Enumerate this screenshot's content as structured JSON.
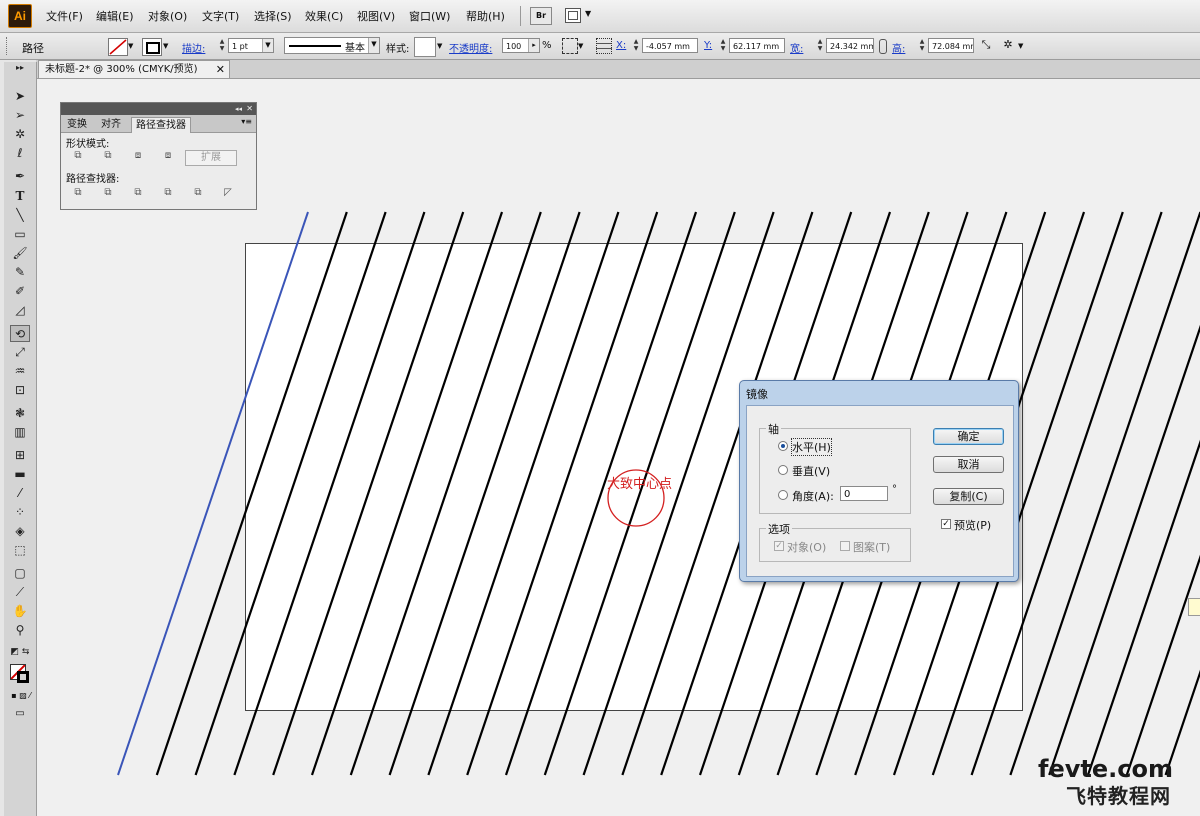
{
  "app": {
    "logo": "Ai"
  },
  "menu": [
    "文件(F)",
    "编辑(E)",
    "对象(O)",
    "文字(T)",
    "选择(S)",
    "效果(C)",
    "视图(V)",
    "窗口(W)",
    "帮助(H)"
  ],
  "control_bar": {
    "selection_label": "路径",
    "stroke_label": "描边:",
    "stroke_weight": "1 pt",
    "brush_label": "基本",
    "style_label": "样式:",
    "opacity_label": "不透明度:",
    "opacity_value": "100",
    "opacity_unit": "%",
    "x_label": "X:",
    "x_value": "-4.057 mm",
    "y_label": "Y:",
    "y_value": "62.117 mm",
    "w_label": "宽:",
    "w_value": "24.342 mm",
    "h_label": "高:",
    "h_value": "72.084 mm",
    "bridge_label": "Br"
  },
  "document": {
    "tab_title": "未标题-2* @ 300% (CMYK/预览)"
  },
  "pathfinder_panel": {
    "tabs": [
      "变换",
      "对齐",
      "路径查找器"
    ],
    "shape_modes_label": "形状模式:",
    "expand_label": "扩展",
    "pathfinders_label": "路径查找器:"
  },
  "annotation": {
    "center_label": "大致中心点"
  },
  "mirror_dialog": {
    "title": "镜像",
    "axis_group": "轴",
    "horizontal": "水平(H)",
    "vertical": "垂直(V)",
    "angle": "角度(A):",
    "angle_value": "0",
    "degree": "°",
    "options_group": "选项",
    "objects": "对象(O)",
    "patterns": "图案(T)",
    "ok": "确定",
    "cancel": "取消",
    "copy": "复制(C)",
    "preview": "预览(P)",
    "selected_axis": "horizontal",
    "preview_checked": true
  },
  "watermark": {
    "line1": "fevte.com",
    "line2": "飞特教程网"
  },
  "colors": {
    "accent_blue": "#1a3cc8",
    "annotation_red": "#d42020",
    "selected_path": "#3a55b8"
  }
}
